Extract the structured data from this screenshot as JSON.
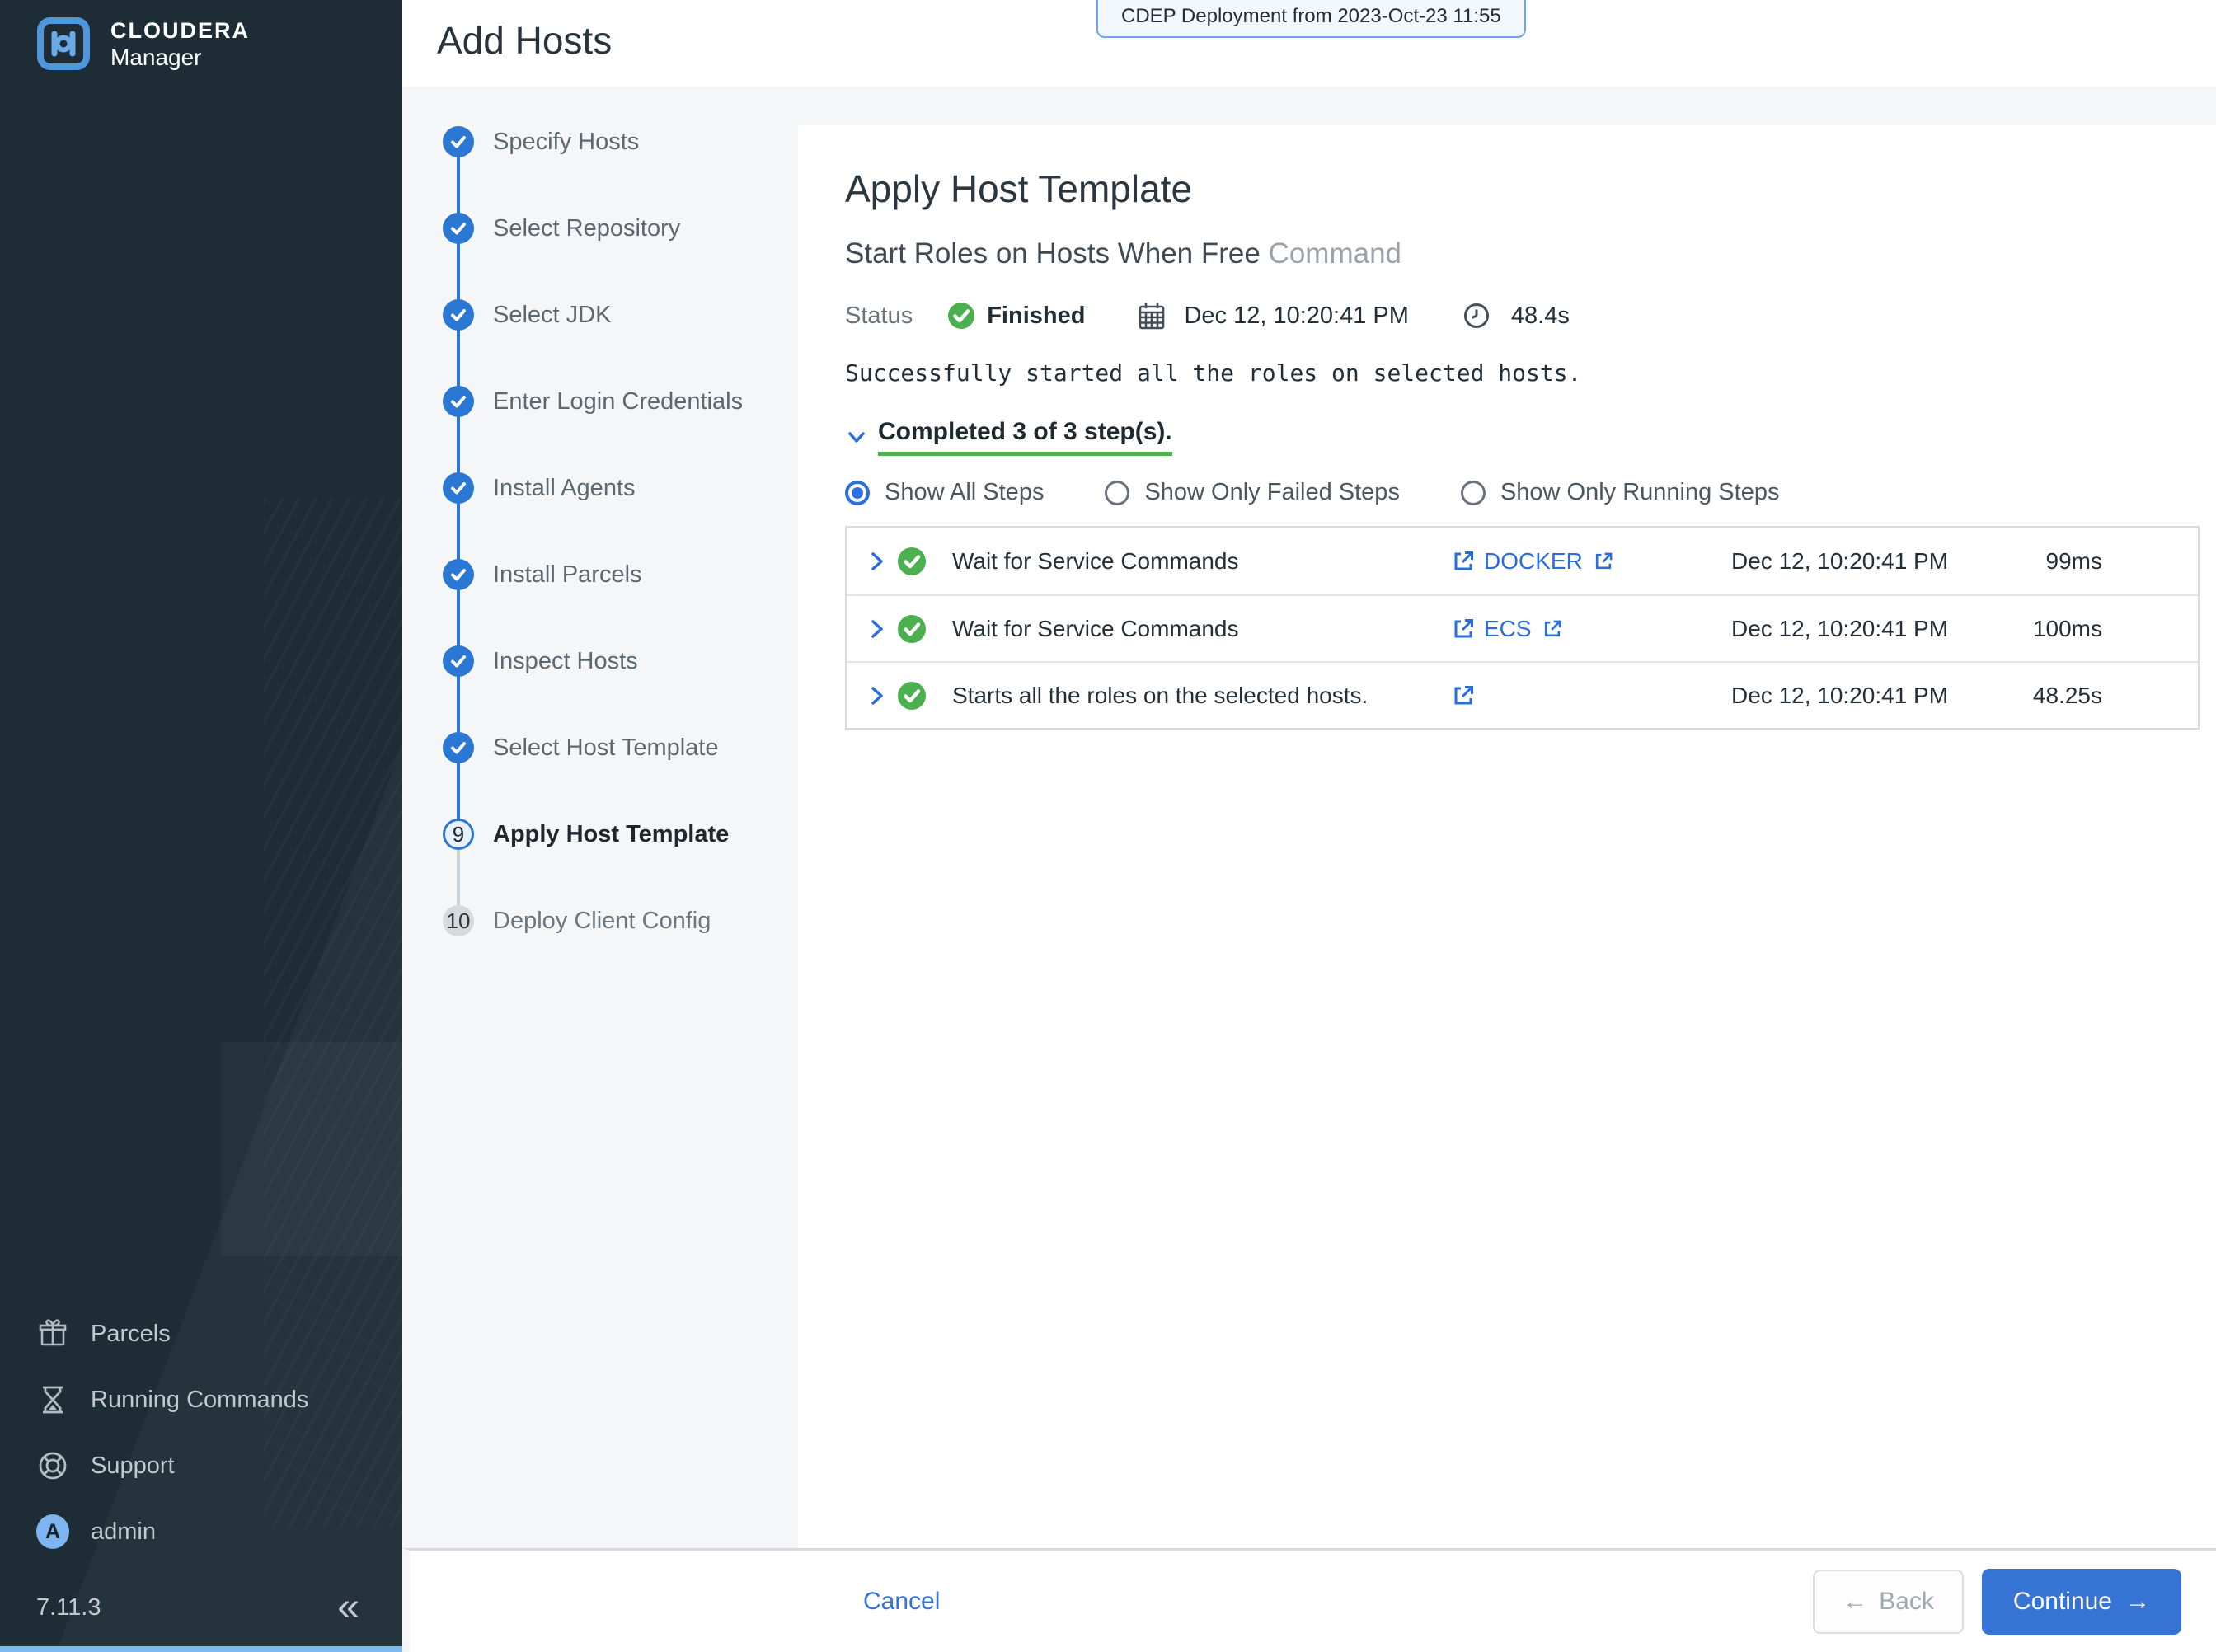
{
  "sidebar": {
    "brand": {
      "line1": "CLOUDERA",
      "line2": "Manager"
    },
    "nav": [
      {
        "label": "Parcels",
        "icon": "gift-icon"
      },
      {
        "label": "Running Commands",
        "icon": "hourglass-icon"
      },
      {
        "label": "Support",
        "icon": "life-ring-icon"
      },
      {
        "label": "admin",
        "icon": "avatar",
        "avatar_letter": "A"
      }
    ],
    "version": "7.11.3",
    "collapse_icon": "«"
  },
  "header": {
    "title": "Add Hosts",
    "deployment_banner": "CDEP Deployment from 2023-Oct-23 11:55"
  },
  "wizard": {
    "steps": [
      {
        "label": "Specify Hosts",
        "state": "done"
      },
      {
        "label": "Select Repository",
        "state": "done"
      },
      {
        "label": "Select JDK",
        "state": "done"
      },
      {
        "label": "Enter Login Credentials",
        "state": "done"
      },
      {
        "label": "Install Agents",
        "state": "done"
      },
      {
        "label": "Install Parcels",
        "state": "done"
      },
      {
        "label": "Inspect Hosts",
        "state": "done"
      },
      {
        "label": "Select Host Template",
        "state": "done"
      },
      {
        "label": "Apply Host Template",
        "state": "current",
        "number": "9"
      },
      {
        "label": "Deploy Client Config",
        "state": "upcoming",
        "number": "10"
      }
    ]
  },
  "command": {
    "page_title": "Apply Host Template",
    "subtitle": "Start Roles on Hosts When Free",
    "subtitle_suffix": "Command",
    "status_label": "Status",
    "status_value": "Finished",
    "timestamp": "Dec 12, 10:20:41 PM",
    "duration": "48.4s",
    "result_message": "Successfully started all the roles on selected hosts.",
    "completed_summary": "Completed 3 of 3 step(s).",
    "filters": [
      {
        "label": "Show All Steps",
        "selected": true
      },
      {
        "label": "Show Only Failed Steps",
        "selected": false
      },
      {
        "label": "Show Only Running Steps",
        "selected": false
      }
    ],
    "steps_table": {
      "rows": [
        {
          "description": "Wait for Service Commands",
          "service": "DOCKER",
          "timestamp": "Dec 12, 10:20:41 PM",
          "duration": "99ms"
        },
        {
          "description": "Wait for Service Commands",
          "service": "ECS",
          "timestamp": "Dec 12, 10:20:41 PM",
          "duration": "100ms"
        },
        {
          "description": "Starts all the roles on the selected hosts.",
          "service": "",
          "timestamp": "Dec 12, 10:20:41 PM",
          "duration": "48.25s"
        }
      ]
    }
  },
  "footer": {
    "cancel_label": "Cancel",
    "back_label": "Back",
    "back_arrow": "←",
    "continue_label": "Continue",
    "continue_arrow": "→"
  },
  "colors": {
    "accent_blue": "#2b77d4",
    "link_blue": "#2a6ddf",
    "success_green": "#4caf50",
    "sidebar_bg": "#1d2c35"
  }
}
